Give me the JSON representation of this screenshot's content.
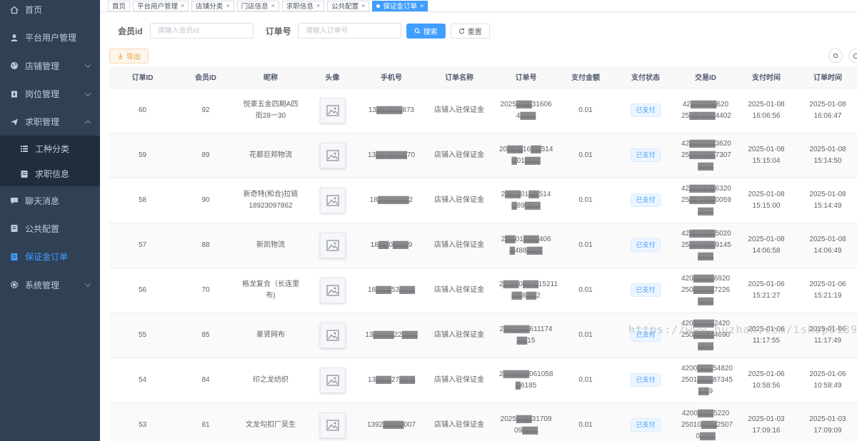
{
  "sidebar": {
    "items": [
      {
        "label": "首页",
        "icon": "home-icon"
      },
      {
        "label": "平台用户管理",
        "icon": "user-icon"
      },
      {
        "label": "店铺管理",
        "icon": "globe-icon"
      },
      {
        "label": "岗位管理",
        "icon": "briefcase-icon"
      },
      {
        "label": "求职管理",
        "icon": "send-icon"
      },
      {
        "label": "工种分类",
        "icon": "list-icon"
      },
      {
        "label": "求职信息",
        "icon": "document-icon"
      },
      {
        "label": "聊天消息",
        "icon": "chat-icon"
      },
      {
        "label": "公共配置",
        "icon": "document-icon"
      },
      {
        "label": "保证金订单",
        "icon": "document-icon"
      },
      {
        "label": "系统管理",
        "icon": "gear-icon"
      }
    ]
  },
  "tags": [
    {
      "label": "首页"
    },
    {
      "label": "平台用户管理"
    },
    {
      "label": "店铺分类"
    },
    {
      "label": "门店信息"
    },
    {
      "label": "求职信息"
    },
    {
      "label": "公共配置"
    },
    {
      "label": "保证金订单"
    }
  ],
  "search": {
    "member_label": "会员id",
    "member_placeholder": "请输入会员id",
    "order_label": "订单号",
    "order_placeholder": "请输入订单号",
    "search_btn": "搜索",
    "reset_btn": "重置"
  },
  "toolbar": {
    "export_btn": "导出"
  },
  "table": {
    "headers": [
      "订单ID",
      "会员ID",
      "昵称",
      "头像",
      "手机号",
      "订单名称",
      "订单号",
      "支付金额",
      "支付状态",
      "交易ID",
      "支付时间",
      "订单时间"
    ],
    "rows": [
      {
        "id": "60",
        "member": "92",
        "nick": "悦豪五金四期A四街28一30",
        "phone": "13▓▓▓▓▓873",
        "name": "店铺入驻保证金",
        "order_no": "2025▓▓▓31606 4▓▓▓",
        "amount": "0.01",
        "status": "已支付",
        "trade": "42▓▓▓▓▓620 25▓▓▓▓▓4402",
        "paytime": "2025-01-08 16:06:56",
        "ordertime": "2025-01-08 16:06:47"
      },
      {
        "id": "59",
        "member": "89",
        "nick": "花都巨邦物流",
        "phone": "13▓▓▓▓▓▓70",
        "name": "店铺入驻保证金",
        "order_no": "20▓▓▓16▓▓514 ▓01▓▓▓",
        "amount": "0.01",
        "status": "已支付",
        "trade": "42▓▓▓▓▓3620 25▓▓▓▓▓7307 ▓▓▓",
        "paytime": "2025-01-08 15:15:04",
        "ordertime": "2025-01-08 15:14:50"
      },
      {
        "id": "58",
        "member": "90",
        "nick": "新奇特(和合)拉链18923097862",
        "phone": "18▓▓▓▓▓▓2",
        "name": "店铺入驻保证金",
        "order_no": "2▓▓▓01▓▓514 ▓89▓▓▓",
        "amount": "0.01",
        "status": "已支付",
        "trade": "42▓▓▓▓▓6320 25▓▓▓▓▓0059 ▓▓▓",
        "paytime": "2025-01-08 15:15:00",
        "ordertime": "2025-01-08 15:14:49"
      },
      {
        "id": "57",
        "member": "88",
        "nick": "新凯物流",
        "phone": "18▓▓0▓▓▓9",
        "name": "店铺入驻保证金",
        "order_no": "2▓▓01▓▓▓406 ▓488▓▓▓",
        "amount": "0.01",
        "status": "已支付",
        "trade": "42▓▓▓▓▓5020 25▓▓▓▓▓9145 ▓▓▓",
        "paytime": "2025-01-08 14:06:58",
        "ordertime": "2025-01-08 14:06:49"
      },
      {
        "id": "56",
        "member": "70",
        "nick": "格龙复合（长连里布)",
        "phone": "18▓▓▓53▓▓▓",
        "name": "店铺入驻保证金",
        "order_no": "2▓▓▓0▓▓▓15211 ▓▓8▓▓2",
        "amount": "0.01",
        "status": "已支付",
        "trade": "420▓▓▓▓6920 250▓▓▓▓7226 ▓▓▓",
        "paytime": "2025-01-06 15:21:27",
        "ordertime": "2025-01-06 15:21:19"
      },
      {
        "id": "55",
        "member": "85",
        "nick": "豪贤网布",
        "phone": "13▓▓▓▓22▓▓▓",
        "name": "店铺入驻保证金",
        "order_no": "2▓▓▓▓▓611174 ▓▓15",
        "amount": "0.01",
        "status": "已支付",
        "trade": "420▓▓▓▓2420 250▓▓▓▓4690 ▓▓▓",
        "paytime": "2025-01-06 11:17:55",
        "ordertime": "2025-01-06 11:17:49"
      },
      {
        "id": "54",
        "member": "84",
        "nick": "印之龙纺织",
        "phone": "13▓▓▓27▓▓▓",
        "name": "店铺入驻保证金",
        "order_no": "2▓▓▓▓▓061058 ▓6185",
        "amount": "0.01",
        "status": "已支付",
        "trade": "4200▓▓▓54820 2501▓▓▓87345 ▓▓9",
        "paytime": "2025-01-06 10:58:56",
        "ordertime": "2025-01-06 10:58:49"
      },
      {
        "id": "53",
        "member": "81",
        "nick": "文龙勾扣厂吴生",
        "phone": "1392▓▓▓▓007",
        "name": "店铺入驻保证金",
        "order_no": "2025▓▓▓31709 09▓▓▓",
        "amount": "0.01",
        "status": "已支付",
        "trade": "4200▓▓▓5220 25010▓▓▓2507 0▓▓▓",
        "paytime": "2025-01-03 17:09:16",
        "ordertime": "2025-01-03 17:09:09"
      }
    ]
  },
  "watermark": "https://www.huzhan.com/ishop51396",
  "colors": {
    "sidebar_bg": "#304156",
    "submenu_bg": "#1f2d3d",
    "primary": "#409eff",
    "warn": "#e6a23c"
  }
}
